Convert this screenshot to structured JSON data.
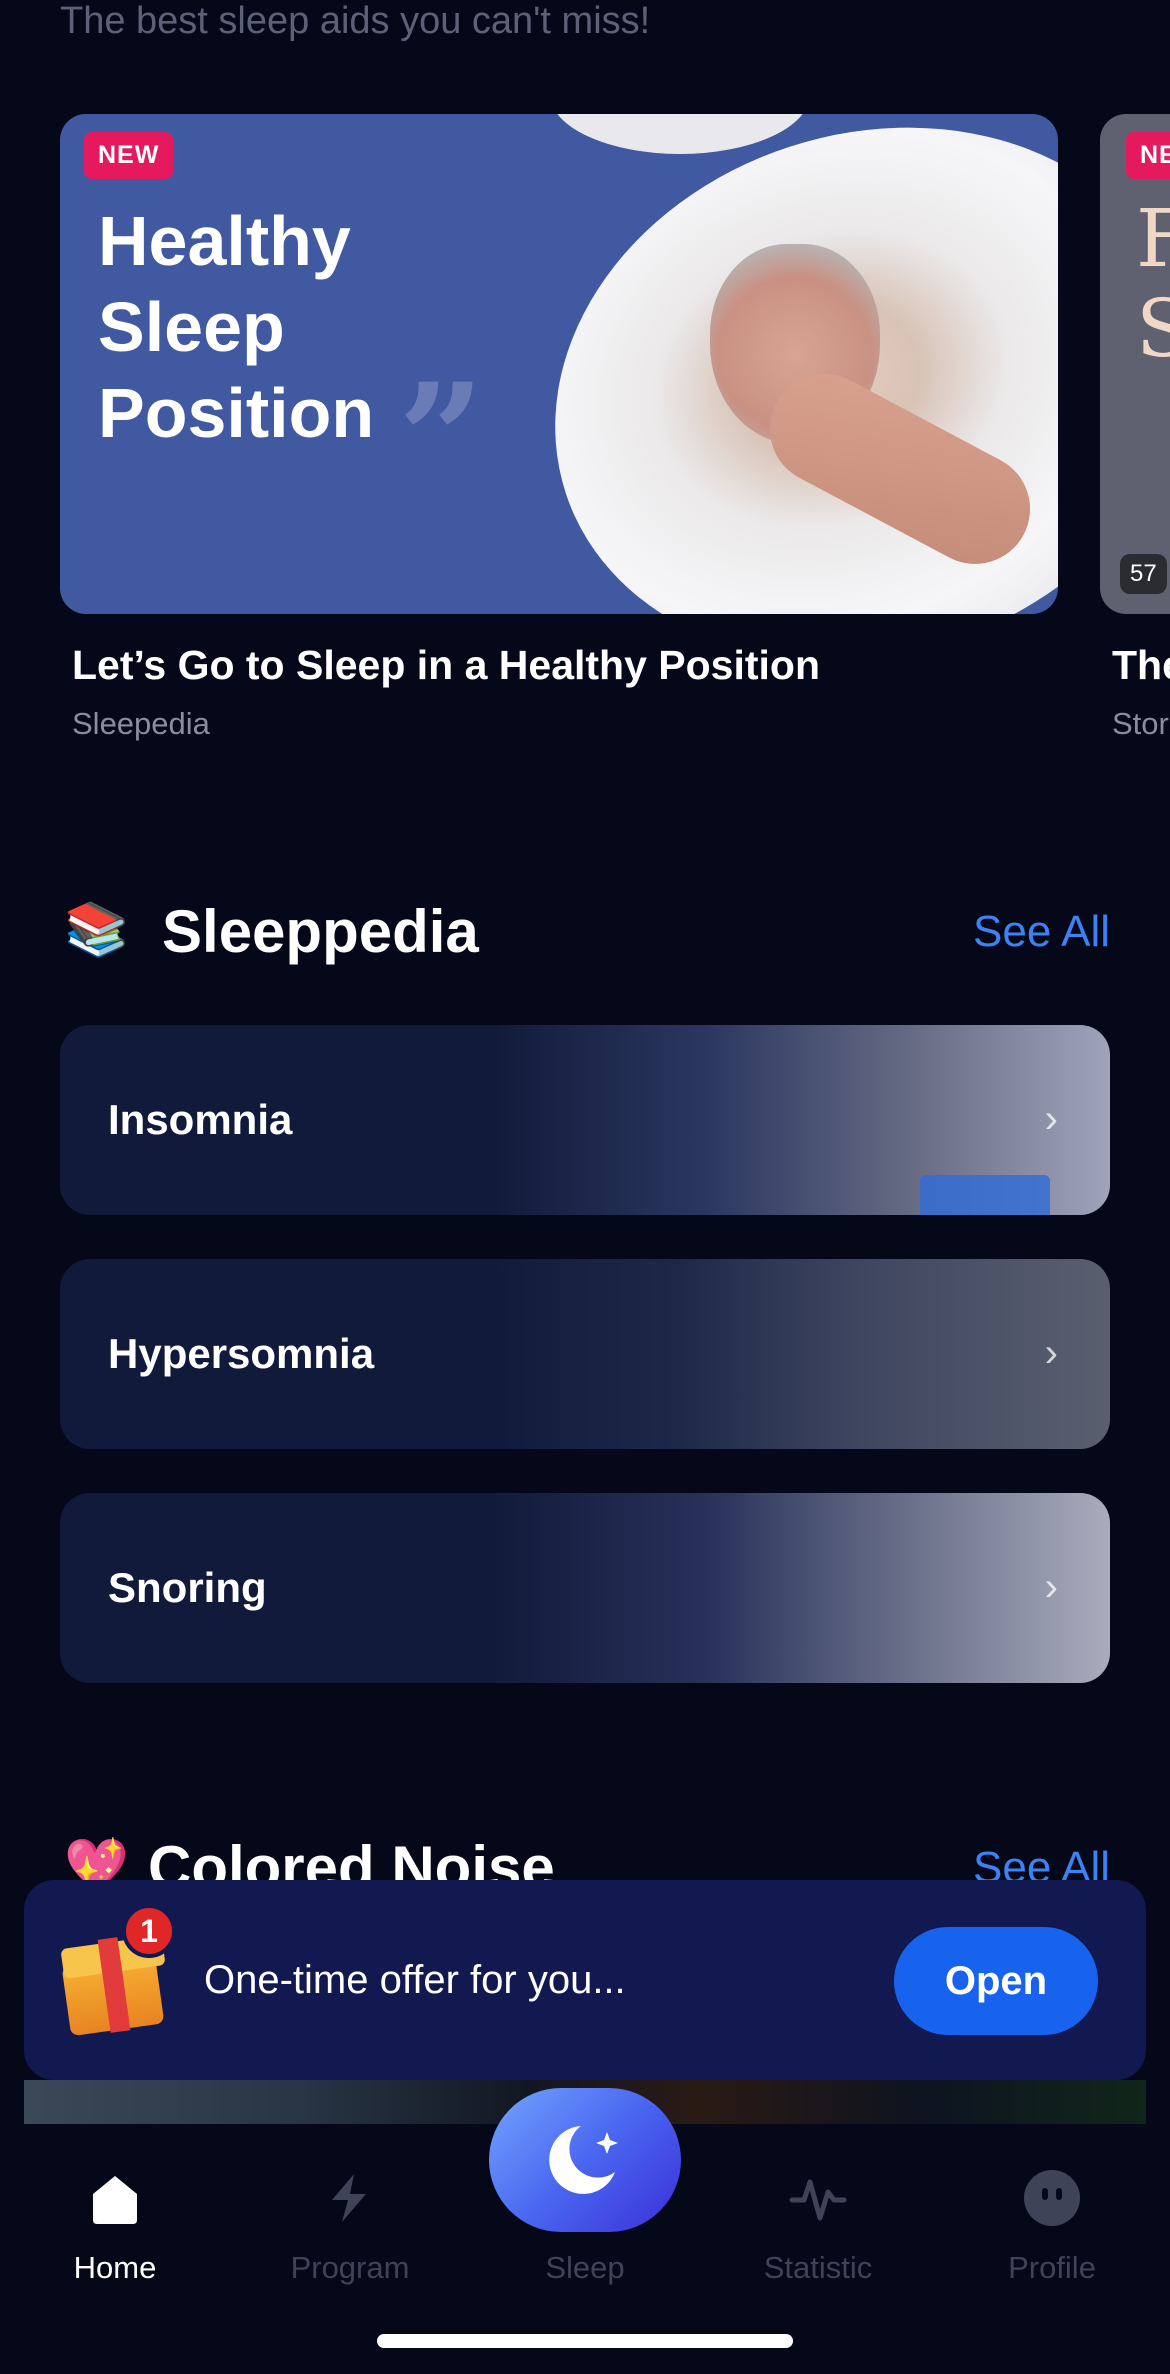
{
  "intro": {
    "subtitle": "The best sleep aids you can't miss!"
  },
  "carousel": [
    {
      "badge": "NEW",
      "headline": "Healthy Sleep Position",
      "title": "Let’s Go to Sleep in a Healthy Position",
      "source": "Sleepedia"
    },
    {
      "badge": "NE",
      "headline": "F S",
      "duration": "57",
      "title": "The",
      "source": "Stor"
    }
  ],
  "sleeppedia": {
    "emoji": "📚",
    "title": "Sleeppedia",
    "see_all": "See All",
    "items": [
      {
        "label": "Insomnia"
      },
      {
        "label": "Hypersomnia"
      },
      {
        "label": "Snoring"
      }
    ]
  },
  "colored_noise": {
    "emoji": "💖",
    "title": "Colored Noise",
    "see_all": "See All"
  },
  "offer": {
    "badge_count": "1",
    "text": "One-time offer for you...",
    "button": "Open"
  },
  "tabbar": {
    "tabs": [
      {
        "label": "Home",
        "icon": "home-icon",
        "active": true
      },
      {
        "label": "Program",
        "icon": "program-icon",
        "active": false
      },
      {
        "label": "Sleep",
        "icon": "moon-icon",
        "active": false
      },
      {
        "label": "Statistic",
        "icon": "statistic-icon",
        "active": false
      },
      {
        "label": "Profile",
        "icon": "profile-icon",
        "active": false
      }
    ]
  },
  "colors": {
    "background": "#050818",
    "accent": "#3b82f6",
    "button": "#1863ee",
    "badge": "#e5195e",
    "banner": "#121950"
  }
}
